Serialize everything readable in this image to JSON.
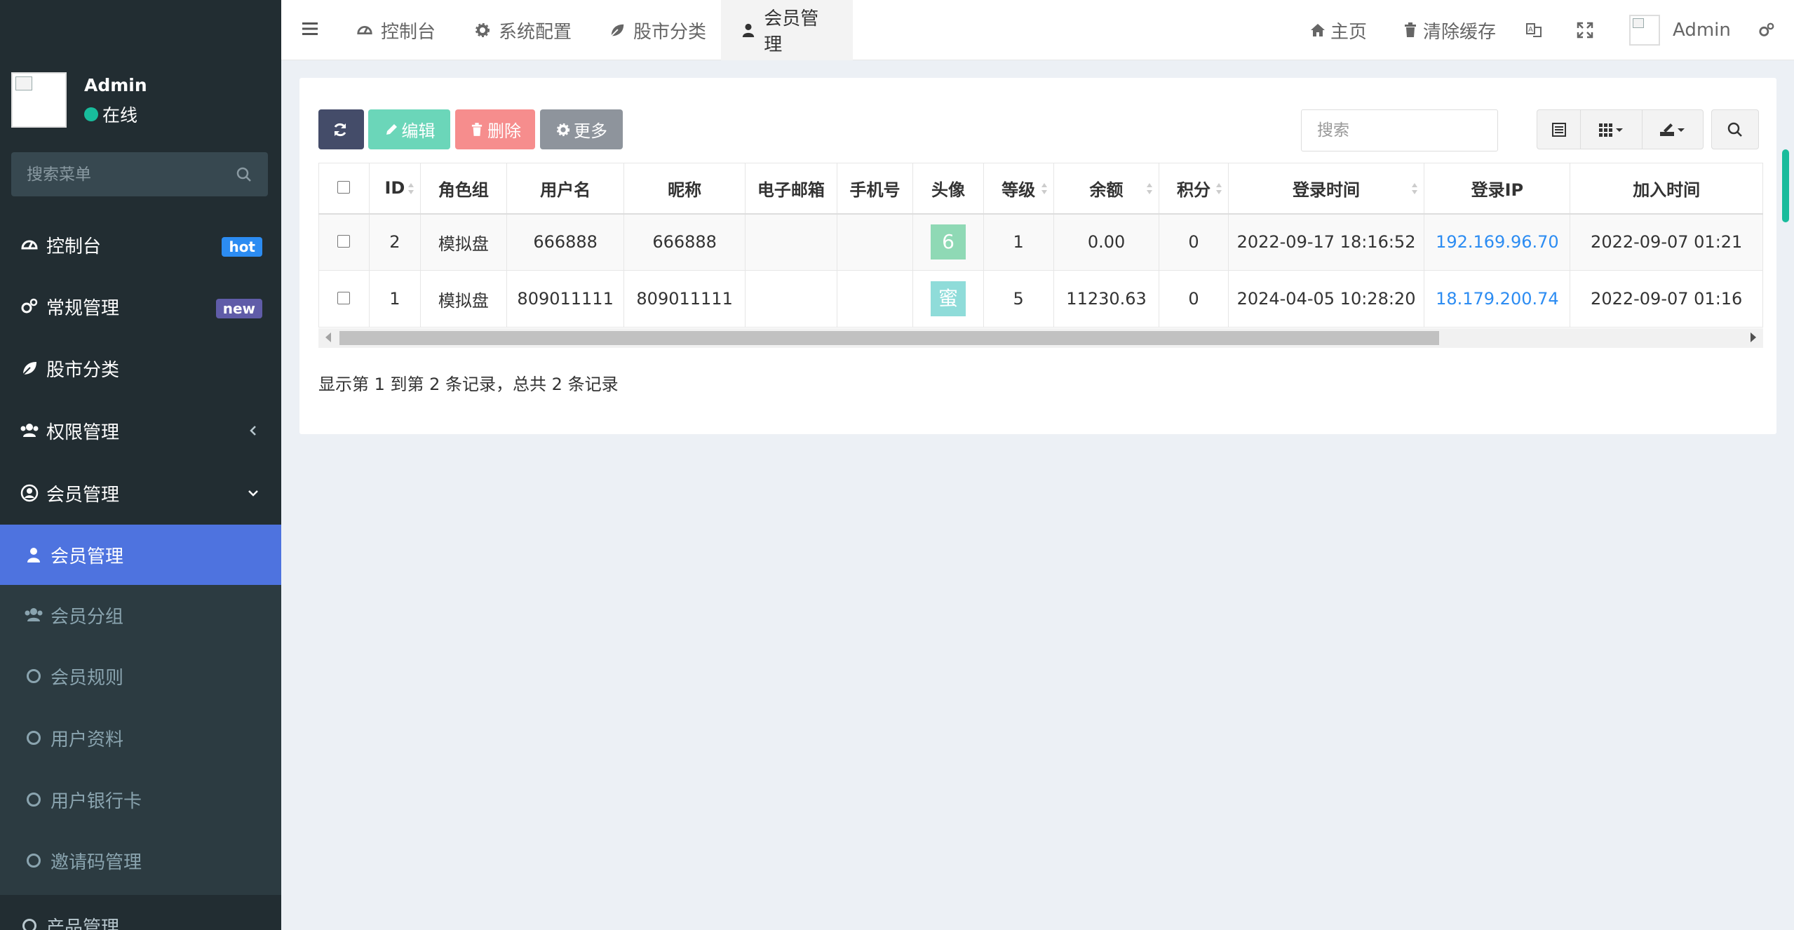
{
  "sidebar": {
    "user": {
      "name": "Admin",
      "status": "在线"
    },
    "search_placeholder": "搜索菜单",
    "menu": [
      {
        "label": "控制台",
        "badge": "hot"
      },
      {
        "label": "常规管理",
        "badge": "new"
      },
      {
        "label": "股市分类"
      },
      {
        "label": "权限管理"
      },
      {
        "label": "会员管理"
      }
    ],
    "submenu": [
      {
        "label": "会员管理"
      },
      {
        "label": "会员分组"
      },
      {
        "label": "会员规则"
      },
      {
        "label": "用户资料"
      },
      {
        "label": "用户银行卡"
      },
      {
        "label": "邀请码管理"
      }
    ],
    "more_label": "产品管理"
  },
  "topbar": {
    "tabs": [
      {
        "label": "控制台"
      },
      {
        "label": "系统配置"
      },
      {
        "label": "股市分类"
      },
      {
        "label": "会员管理"
      }
    ],
    "home_label": "主页",
    "clear_cache_label": "清除缓存",
    "admin_label": "Admin"
  },
  "toolbar": {
    "edit_label": "编辑",
    "delete_label": "删除",
    "more_label": "更多",
    "search_placeholder": "搜索"
  },
  "table": {
    "headers": [
      "ID",
      "角色组",
      "用户名",
      "昵称",
      "电子邮箱",
      "手机号",
      "头像",
      "等级",
      "余额",
      "积分",
      "登录时间",
      "登录IP",
      "加入时间"
    ],
    "rows": [
      {
        "id": "2",
        "group": "模拟盘",
        "username": "666888",
        "nickname": "666888",
        "email": "",
        "mobile": "",
        "avatar": "6",
        "avatar_color": "#8fd9b5",
        "level": "1",
        "balance": "0.00",
        "score": "0",
        "login_time": "2022-09-17 18:16:52",
        "login_ip": "192.169.96.70",
        "join_time": "2022-09-07 01:21"
      },
      {
        "id": "1",
        "group": "模拟盘",
        "username": "809011111",
        "nickname": "809011111",
        "email": "",
        "mobile": "",
        "avatar": "蜜",
        "avatar_color": "#8fdcd9",
        "level": "5",
        "balance": "11230.63",
        "score": "0",
        "login_time": "2024-04-05 10:28:20",
        "login_ip": "18.179.200.74",
        "join_time": "2022-09-07 01:16"
      }
    ]
  },
  "pagination_text": "显示第 1 到第 2 条记录，总共 2 条记录",
  "colors": {
    "sidebar_bg": "#222d32",
    "active_item": "#4e73df",
    "accent_green": "#18bc9c",
    "link_blue": "#2c8cf2"
  }
}
